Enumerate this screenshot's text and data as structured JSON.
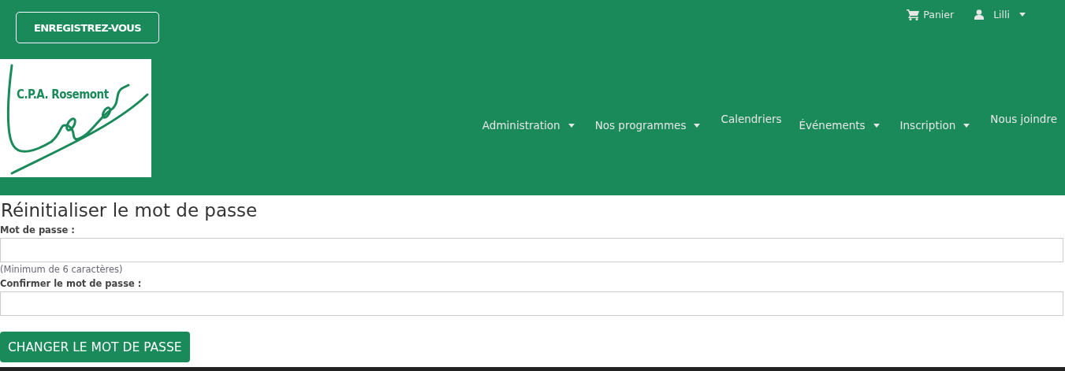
{
  "header": {
    "register_button": "ENREGISTREZ-VOUS",
    "cart": "Panier",
    "user": "Lilli",
    "logo_text": "C.P.A. Rosemont",
    "nav": [
      {
        "label": "Administration",
        "dropdown": true
      },
      {
        "label": "Nos programmes",
        "dropdown": true
      },
      {
        "label": "Calendriers",
        "dropdown": false
      },
      {
        "label": "Événements",
        "dropdown": true
      },
      {
        "label": "Inscription",
        "dropdown": true
      },
      {
        "label": "Nous joindre",
        "dropdown": false
      }
    ]
  },
  "form": {
    "title": "Réinitialiser le mot de passe",
    "fields": [
      {
        "label": "Mot de passe :",
        "hint": "(Minimum de 6 caractères)"
      },
      {
        "label": "Confirmer le mot de passe :"
      }
    ],
    "submit": "CHANGER LE MOT DE PASSE"
  }
}
